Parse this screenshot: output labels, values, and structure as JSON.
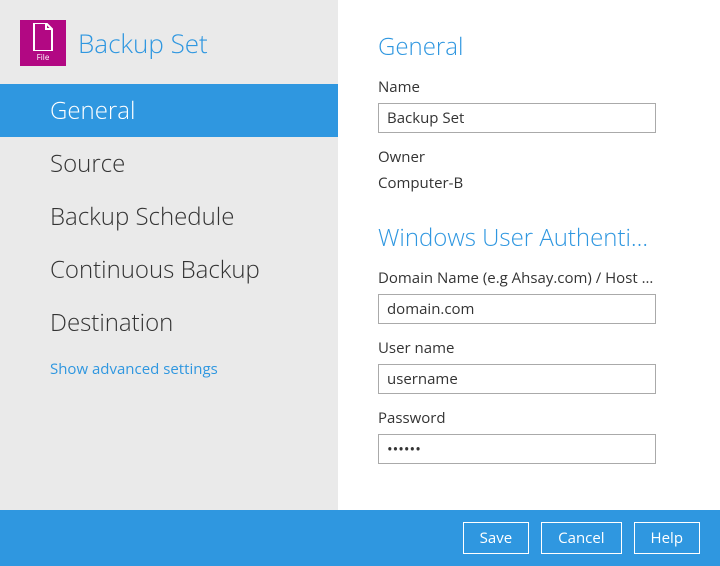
{
  "sidebar": {
    "icon_label": "File",
    "title": "Backup Set",
    "items": [
      {
        "label": "General",
        "active": true
      },
      {
        "label": "Source",
        "active": false
      },
      {
        "label": "Backup Schedule",
        "active": false
      },
      {
        "label": "Continuous Backup",
        "active": false
      },
      {
        "label": "Destination",
        "active": false
      }
    ],
    "advanced_link": "Show advanced settings"
  },
  "main": {
    "general": {
      "heading": "General",
      "name_label": "Name",
      "name_value": "Backup Set",
      "owner_label": "Owner",
      "owner_value": "Computer-B"
    },
    "auth": {
      "heading": "Windows User Authentic...",
      "domain_label": "Domain Name (e.g Ahsay.com) / Host N...",
      "domain_value": "domain.com",
      "username_label": "User name",
      "username_value": "username",
      "password_label": "Password",
      "password_value": "••••••"
    }
  },
  "footer": {
    "save": "Save",
    "cancel": "Cancel",
    "help": "Help"
  }
}
